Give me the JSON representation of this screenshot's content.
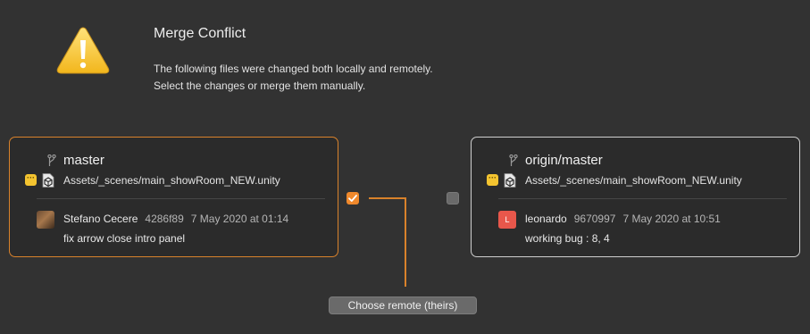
{
  "dialog": {
    "title": "Merge Conflict",
    "message_line1": "The following files were changed both locally and remotely.",
    "message_line2": "Select the changes or merge them manually.",
    "icon": "warning-triangle-icon"
  },
  "local": {
    "branch": "master",
    "branch_icon": "branch-icon",
    "status_icon": "modified-badge-icon",
    "status_glyph": "···",
    "file_icon": "unity-file-icon",
    "file_path": "Assets/_scenes/main_showRoom_NEW.unity",
    "author": "Stefano Cecere",
    "hash": "4286f89",
    "date": "7 May 2020 at 01:14",
    "message": "fix arrow close intro panel",
    "selected": true,
    "accent_color": "#d9822b"
  },
  "remote": {
    "branch": "origin/master",
    "branch_icon": "branch-icon",
    "status_icon": "modified-badge-icon",
    "status_glyph": "···",
    "file_icon": "unity-file-icon",
    "file_path": "Assets/_scenes/main_showRoom_NEW.unity",
    "author": "leonardo",
    "avatar_letter": "L",
    "avatar_color": "#e8574b",
    "hash": "9670997",
    "date": "7 May 2020 at 10:51",
    "message": "working bug : 8, 4",
    "selected": false
  },
  "action": {
    "label": "Choose remote (theirs)"
  }
}
